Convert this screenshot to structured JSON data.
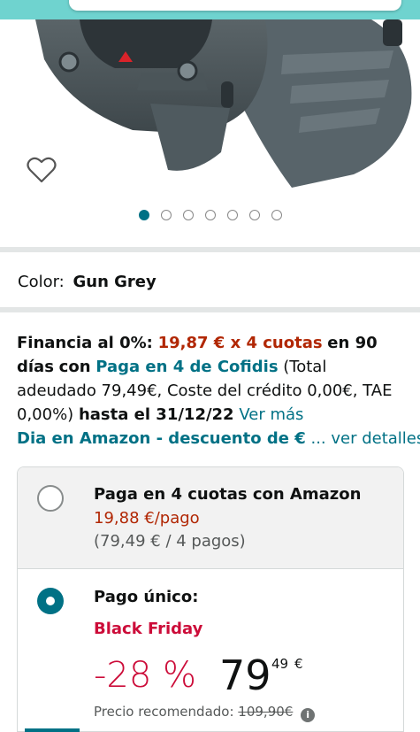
{
  "product": {
    "image_alt": "Gun Grey smartwatch",
    "carousel": {
      "count": 7,
      "active_index": 0
    }
  },
  "color": {
    "label": "Color:",
    "value": "Gun Grey"
  },
  "financing": {
    "lead": "Financia al 0%:",
    "amount": "19,87 € x 4 cuotas",
    "days": "en 90 días",
    "con": "con",
    "provider": "Paga en 4 de Cofidis",
    "terms": "(Total adeudado 79,49€, Coste del crédito 0,00€, TAE 0,00%)",
    "until": "hasta el 31/12/22",
    "more_link": "Ver más"
  },
  "deal": {
    "text": "Dia en Amazon - descuento de €",
    "details_link": "... ver detalles"
  },
  "options": {
    "installments": {
      "title": "Paga en 4 cuotas con Amazon",
      "price": "19,88 €/pago",
      "sub": "(79,49 € / 4 pagos)"
    },
    "single": {
      "title": "Pago único:",
      "badge": "Black Friday",
      "discount": "-28 %",
      "price_whole": "79",
      "price_fraction": "49",
      "currency": "€",
      "recommended_label": "Precio recomendado:",
      "recommended_price": "109,90€"
    }
  },
  "colors": {
    "accent": "#007185",
    "price_red": "#b12704",
    "deal_red": "#cc0c39",
    "header": "#6fd3cf"
  }
}
